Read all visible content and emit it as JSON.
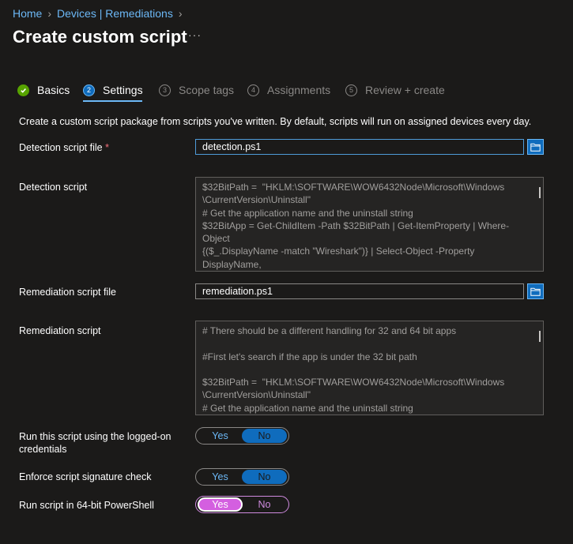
{
  "breadcrumb": [
    "Home",
    "Devices | Remediations"
  ],
  "title": "Create custom script",
  "more_label": "···",
  "steps": [
    {
      "num": "",
      "label": "Basics",
      "state": "done"
    },
    {
      "num": "2",
      "label": "Settings",
      "state": "active"
    },
    {
      "num": "3",
      "label": "Scope tags",
      "state": "pending"
    },
    {
      "num": "4",
      "label": "Assignments",
      "state": "pending"
    },
    {
      "num": "5",
      "label": "Review + create",
      "state": "pending"
    }
  ],
  "intro": "Create a custom script package from scripts you've written. By default, scripts will run on assigned devices every day.",
  "detection_file": {
    "label": "Detection script file",
    "required_mark": "*",
    "value": "detection.ps1"
  },
  "detection_script": {
    "label": "Detection script",
    "content": "$32BitPath =  \"HKLM:\\SOFTWARE\\WOW6432Node\\Microsoft\\Windows\n\\CurrentVersion\\Uninstall\"\n# Get the application name and the uninstall string\n$32BitApp = Get-ChildItem -Path $32BitPath | Get-ItemProperty | Where-Object\n{($_.DisplayName -match \"Wireshark\")} | Select-Object -Property DisplayName,\nUninstallString"
  },
  "remediation_file": {
    "label": "Remediation script file",
    "value": "remediation.ps1"
  },
  "remediation_script": {
    "label": "Remediation script",
    "content": "# There should be a different handling for 32 and 64 bit apps\n\n#First let's search if the app is under the 32 bit path\n\n$32BitPath =  \"HKLM:\\SOFTWARE\\WOW6432Node\\Microsoft\\Windows\n\\CurrentVersion\\Uninstall\"\n# Get the application name and the uninstall string"
  },
  "toggles": [
    {
      "label": "Run this script using the logged-on credentials",
      "yes": "Yes",
      "no": "No",
      "selected": "No"
    },
    {
      "label": "Enforce script signature check",
      "yes": "Yes",
      "no": "No",
      "selected": "No"
    },
    {
      "label": "Run script in 64-bit PowerShell",
      "yes": "Yes",
      "no": "No",
      "selected": "Yes"
    }
  ],
  "colors": {
    "accent": "#0f6cbd",
    "link": "#6cb8f6",
    "success": "#57a300",
    "highlight": "#d45fe0"
  }
}
